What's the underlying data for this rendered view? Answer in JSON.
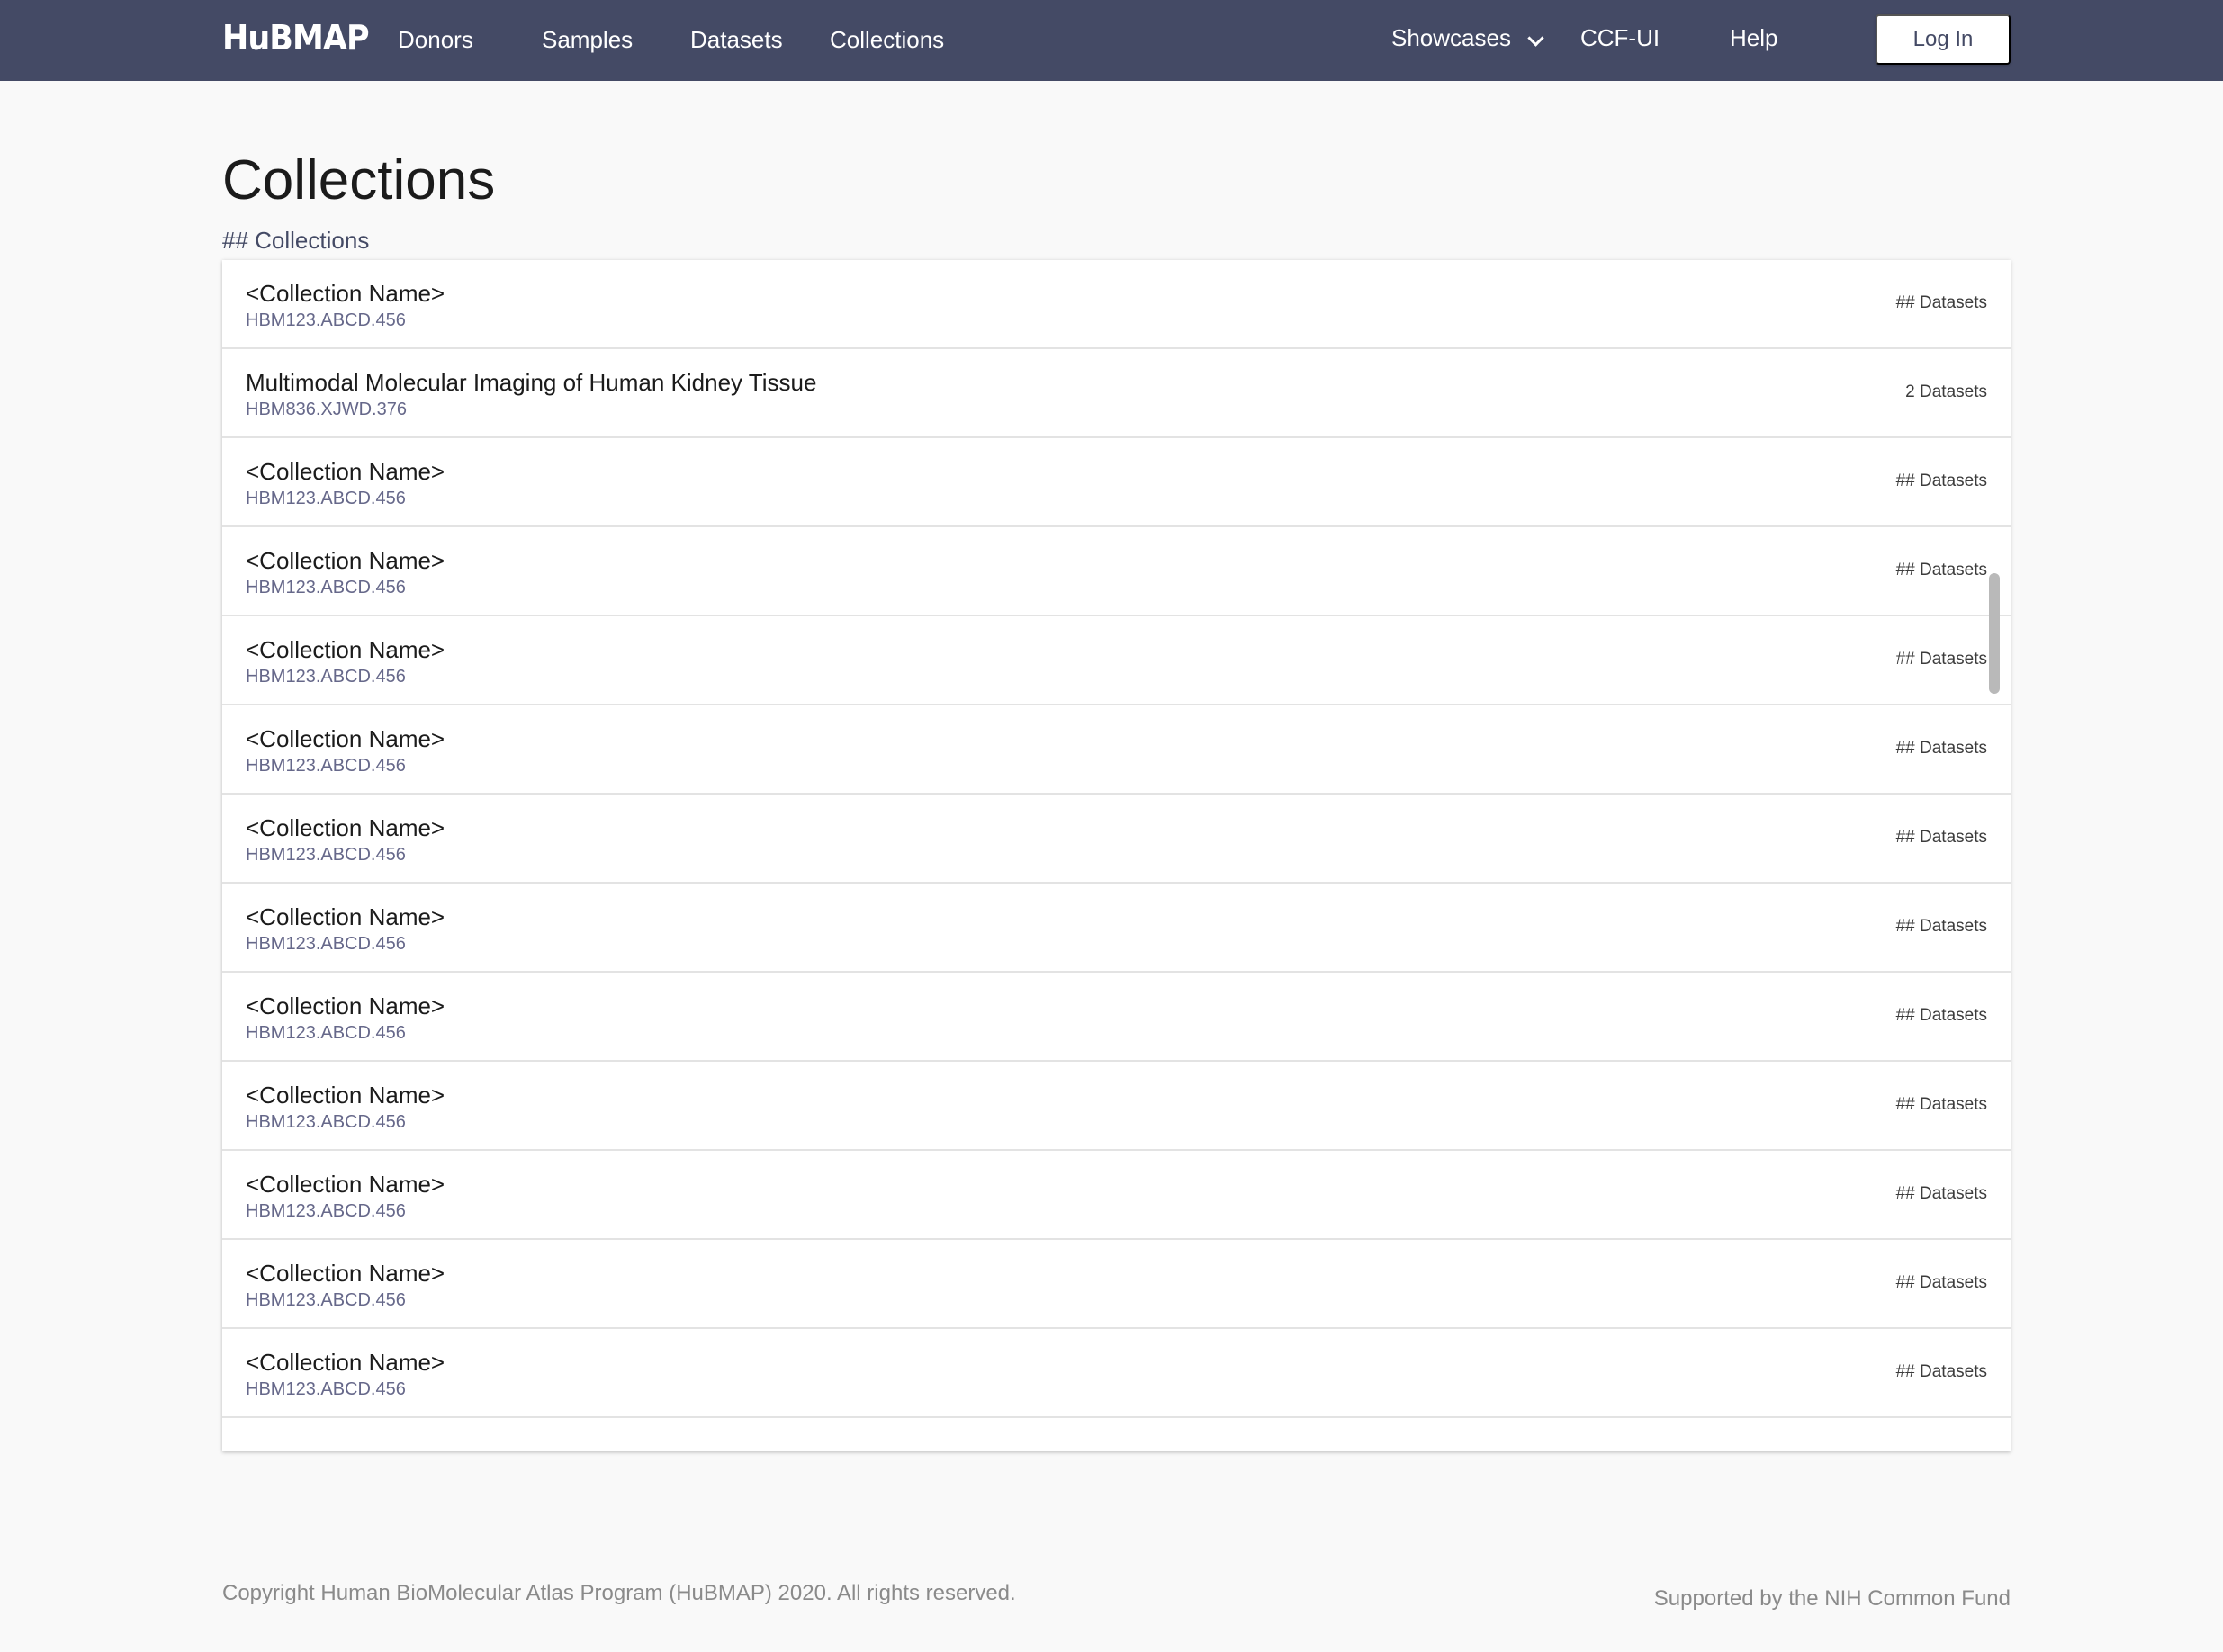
{
  "header": {
    "logo": "HuBMAP",
    "nav_left": [
      "Donors",
      "Samples",
      "Datasets",
      "Collections"
    ],
    "nav_right": {
      "showcases": "Showcases",
      "ccf_ui": "CCF-UI",
      "help": "Help",
      "login": "Log In"
    }
  },
  "main": {
    "title": "Collections",
    "count_label": "## Collections",
    "collections": [
      {
        "name": "<Collection Name>",
        "id": "HBM123.ABCD.456",
        "datasets": "## Datasets"
      },
      {
        "name": "Multimodal Molecular Imaging of Human Kidney Tissue",
        "id": "HBM836.XJWD.376",
        "datasets": "2 Datasets"
      },
      {
        "name": "<Collection Name>",
        "id": "HBM123.ABCD.456",
        "datasets": "## Datasets"
      },
      {
        "name": "<Collection Name>",
        "id": "HBM123.ABCD.456",
        "datasets": "## Datasets"
      },
      {
        "name": "<Collection Name>",
        "id": "HBM123.ABCD.456",
        "datasets": "## Datasets"
      },
      {
        "name": "<Collection Name>",
        "id": "HBM123.ABCD.456",
        "datasets": "## Datasets"
      },
      {
        "name": "<Collection Name>",
        "id": "HBM123.ABCD.456",
        "datasets": "## Datasets"
      },
      {
        "name": "<Collection Name>",
        "id": "HBM123.ABCD.456",
        "datasets": "## Datasets"
      },
      {
        "name": "<Collection Name>",
        "id": "HBM123.ABCD.456",
        "datasets": "## Datasets"
      },
      {
        "name": "<Collection Name>",
        "id": "HBM123.ABCD.456",
        "datasets": "## Datasets"
      },
      {
        "name": "<Collection Name>",
        "id": "HBM123.ABCD.456",
        "datasets": "## Datasets"
      },
      {
        "name": "<Collection Name>",
        "id": "HBM123.ABCD.456",
        "datasets": "## Datasets"
      },
      {
        "name": "<Collection Name>",
        "id": "HBM123.ABCD.456",
        "datasets": "## Datasets"
      }
    ]
  },
  "footer": {
    "copyright": "Copyright Human BioMolecular Atlas Program (HuBMAP) 2020. All rights reserved.",
    "support": "Supported by the NIH Common Fund"
  },
  "colors": {
    "navbar": "#444a65",
    "background": "#f9f9f9",
    "accent": "#444a65"
  },
  "icons": {
    "showcases_dropdown": "chevron-down-icon"
  }
}
